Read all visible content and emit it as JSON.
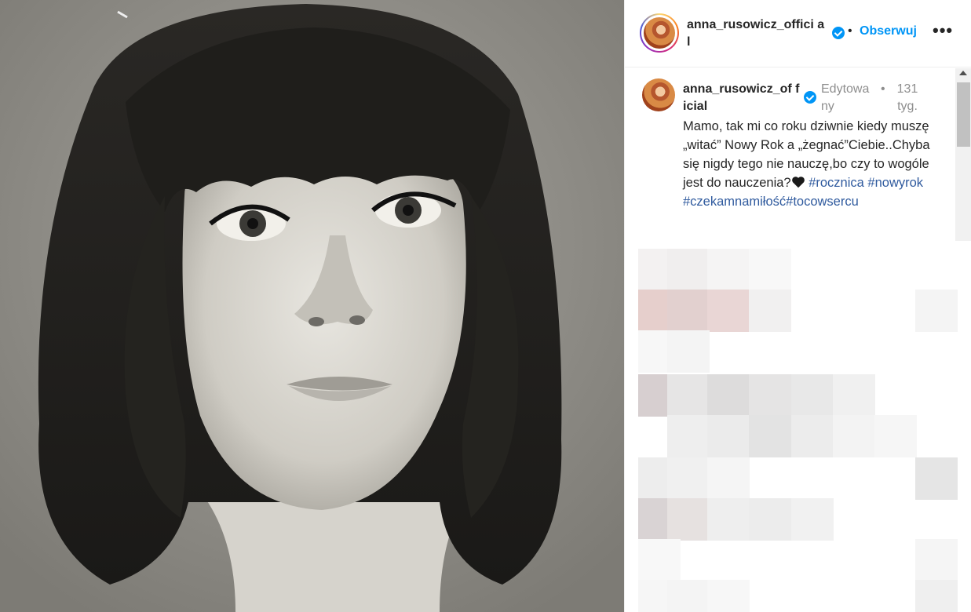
{
  "post": {
    "username": "anna_rusowicz_official",
    "username_header": "anna_rusowicz_offici al",
    "header_separator": "•",
    "follow_label": "Obserwuj",
    "more_label": "•••",
    "photo_description_icon": "portrait-photo",
    "verified_icon": "verified-badge-icon"
  },
  "caption": {
    "username": "anna_rusowicz_of ficial",
    "edited_label": "Edytowa ny",
    "separator": "•",
    "time_label": "131 tyg.",
    "text_line1": "Mamo, tak mi co roku dziwnie kiedy muszę „witać” Nowy Rok a „żegnać”Ciebie..Chyba się nigdy tego nie nauczę,bo czy to wogóle jest do nauczenia?",
    "hashtags": [
      "#rocznica",
      "#nowyrok",
      "#czekamnamiłość",
      "#tocowsercu"
    ]
  },
  "colors": {
    "accent": "#0095f6",
    "hashtag": "#2f5a9e",
    "muted": "#8e8e8e",
    "text": "#262626"
  }
}
